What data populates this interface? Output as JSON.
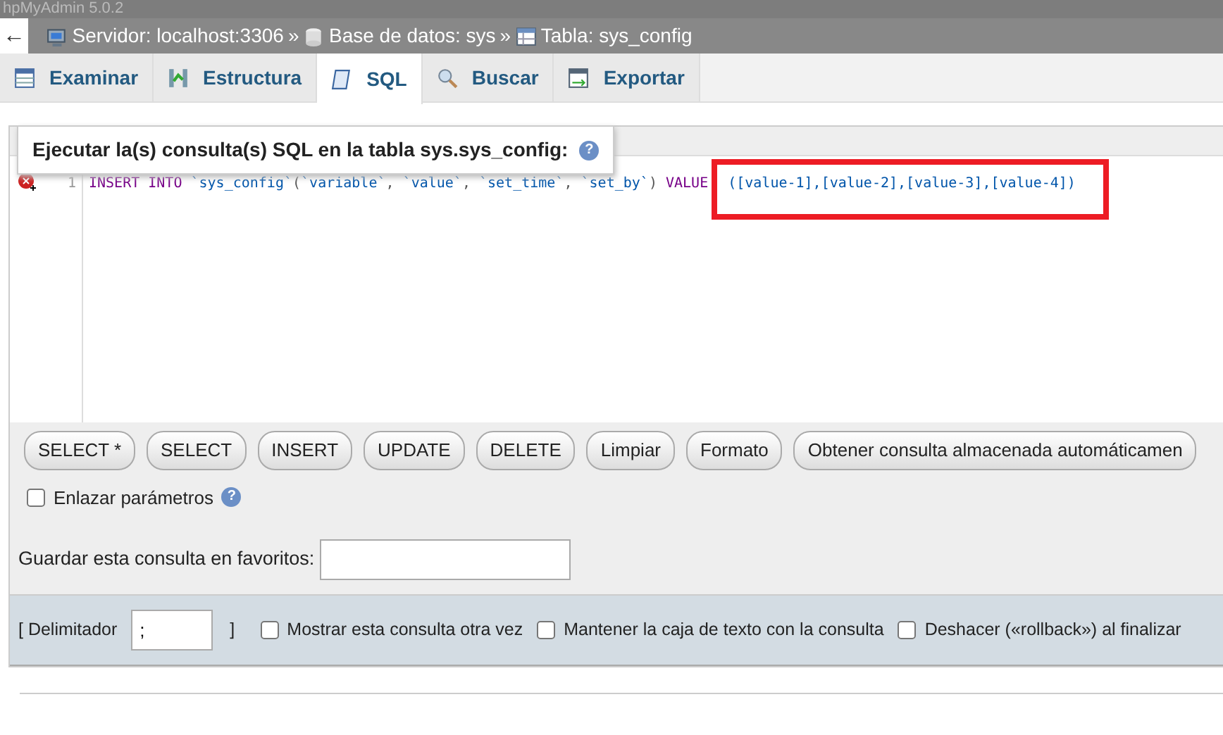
{
  "window": {
    "title": "hpMyAdmin 5.0.2"
  },
  "breadcrumb": {
    "back": "←",
    "items": [
      {
        "kind": "server",
        "label": "Servidor: localhost:3306"
      },
      {
        "kind": "database",
        "label": "Base de datos: sys"
      },
      {
        "kind": "table",
        "label": "Tabla: sys_config"
      }
    ],
    "separator": "»"
  },
  "tabs": [
    {
      "kind": "browse",
      "label": "Examinar",
      "selected": false
    },
    {
      "kind": "structure",
      "label": "Estructura",
      "selected": false
    },
    {
      "kind": "sql",
      "label": "SQL",
      "selected": true
    },
    {
      "kind": "search",
      "label": "Buscar",
      "selected": false
    },
    {
      "kind": "export",
      "label": "Exportar",
      "selected": false
    }
  ],
  "legend": "Ejecutar la(s) consulta(s) SQL en la tabla sys.sys_config:",
  "legend_help": "?",
  "editor": {
    "line_number": "1",
    "error": true,
    "tokens": [
      {
        "text": "INSERT INTO ",
        "kind": "keyword",
        "highlighted": false
      },
      {
        "text": "`sys_config`",
        "kind": "ident",
        "highlighted": false
      },
      {
        "text": "(",
        "kind": "punct",
        "highlighted": false
      },
      {
        "text": "`variable`",
        "kind": "ident",
        "highlighted": false
      },
      {
        "text": ", ",
        "kind": "punct",
        "highlighted": false
      },
      {
        "text": "`value`",
        "kind": "ident",
        "highlighted": false
      },
      {
        "text": ", ",
        "kind": "punct",
        "highlighted": false
      },
      {
        "text": "`set_time`",
        "kind": "ident",
        "highlighted": false
      },
      {
        "text": ", ",
        "kind": "punct",
        "highlighted": false
      },
      {
        "text": "`set_by`",
        "kind": "ident",
        "highlighted": false
      },
      {
        "text": ") ",
        "kind": "punct",
        "highlighted": false
      },
      {
        "text": "VALUE",
        "kind": "keyword",
        "highlighted": false
      },
      {
        "text": "([value-1],[value-2],[value-3],[value-4])",
        "kind": "ident",
        "highlighted": true
      }
    ]
  },
  "buttons": [
    "SELECT *",
    "SELECT",
    "INSERT",
    "UPDATE",
    "DELETE",
    "Limpiar",
    "Formato",
    "Obtener consulta almacenada automáticamen"
  ],
  "bind_params": {
    "label": "Enlazar parámetros",
    "checked": false,
    "help": "?"
  },
  "bookmark": {
    "label": "Guardar esta consulta en favoritos:"
  },
  "options": {
    "delimiter_label": "[ Delimitador",
    "delimiter_value": ";",
    "delimiter_close": "]",
    "checks": [
      {
        "label": "Mostrar esta consulta otra vez",
        "checked": false
      },
      {
        "label": "Mantener la caja de texto con la consulta",
        "checked": false
      },
      {
        "label": "Deshacer («rollback») al finalizar",
        "checked": false
      }
    ]
  }
}
